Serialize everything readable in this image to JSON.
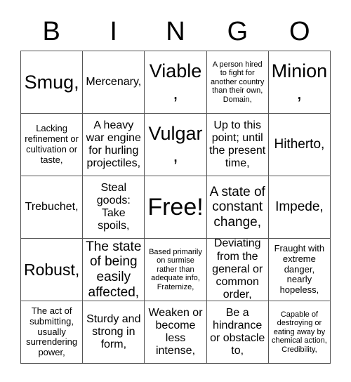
{
  "card": {
    "title_letters": [
      "B",
      "I",
      "N",
      "G",
      "O"
    ],
    "grid": {
      "columns": 5,
      "rows": 5,
      "cells": [
        {
          "text": "Smug,",
          "size": "sz-xxl",
          "free": false
        },
        {
          "text": "Mercenary,",
          "size": "sz-m",
          "free": false
        },
        {
          "text": "Viable,",
          "size": "sz-xxl",
          "free": false
        },
        {
          "text": "A person hired to fight for another country than their own, Domain,",
          "size": "sz-xs",
          "free": false
        },
        {
          "text": "Minion,",
          "size": "sz-xxl",
          "free": false
        },
        {
          "text": "Lacking refinement or cultivation or taste,",
          "size": "sz-s",
          "free": false
        },
        {
          "text": "A heavy war engine for hurling projectiles,",
          "size": "sz-m",
          "free": false
        },
        {
          "text": "Vulgar,",
          "size": "sz-xxl",
          "free": false
        },
        {
          "text": "Up to this point; until the present time,",
          "size": "sz-m",
          "free": false
        },
        {
          "text": "Hitherto,",
          "size": "sz-l",
          "free": false
        },
        {
          "text": "Trebuchet,",
          "size": "sz-m",
          "free": false
        },
        {
          "text": "Steal goods: Take spoils,",
          "size": "sz-m",
          "free": false
        },
        {
          "text": "Free!",
          "size": "free",
          "free": true
        },
        {
          "text": "A state of constant change,",
          "size": "sz-l",
          "free": false
        },
        {
          "text": "Impede,",
          "size": "sz-l",
          "free": false
        },
        {
          "text": "Robust,",
          "size": "sz-xl",
          "free": false
        },
        {
          "text": "The state of being easily affected,",
          "size": "sz-l",
          "free": false
        },
        {
          "text": "Based primarily on surmise rather than adequate info, Fraternize,",
          "size": "sz-xs",
          "free": false
        },
        {
          "text": "Deviating from the general or common order,",
          "size": "sz-m",
          "free": false
        },
        {
          "text": "Fraught with extreme danger, nearly hopeless,",
          "size": "sz-s",
          "free": false
        },
        {
          "text": "The act of submitting, usually surrendering power,",
          "size": "sz-s",
          "free": false
        },
        {
          "text": "Sturdy and strong in form,",
          "size": "sz-m",
          "free": false
        },
        {
          "text": "Weaken or become less intense,",
          "size": "sz-m",
          "free": false
        },
        {
          "text": "Be a hindrance or obstacle to,",
          "size": "sz-m",
          "free": false
        },
        {
          "text": "Capable of destroying or eating away by chemical action, Credibility,",
          "size": "sz-xs",
          "free": false
        }
      ]
    }
  }
}
